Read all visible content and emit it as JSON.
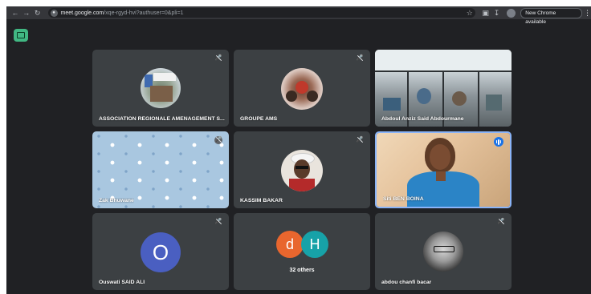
{
  "browser": {
    "url_domain": "meet.google.com",
    "url_path": "/xqe-rgyd-hvi?authuser=0&pli=1",
    "chrome_available": "New Chrome available"
  },
  "tiles": [
    {
      "name": "ASSOCIATION REGIONALE AMENAGEMENT S..."
    },
    {
      "name": "GROUPE AMS"
    },
    {
      "name": "Abdoul Anziz Said Abdourmane"
    },
    {
      "name": "Zak Bhuwane"
    },
    {
      "name": "KASSIM BAKAR"
    },
    {
      "name": "Siti BEN BOINA"
    },
    {
      "name": "Ouswati SAID ALI",
      "avatar_letter": "O"
    },
    {
      "name": "32 others",
      "avatar_letters": [
        "d",
        "H"
      ]
    },
    {
      "name": "abdou chanfi bacar"
    }
  ],
  "colors": {
    "meet_bg": "#202124",
    "tile_bg": "#3c4043",
    "avatar_o": "#4a5fc1",
    "avatar_d": "#e8662e",
    "avatar_h": "#17a2a8",
    "speaking": "#1a73e8",
    "meet_button": "#41b883"
  }
}
